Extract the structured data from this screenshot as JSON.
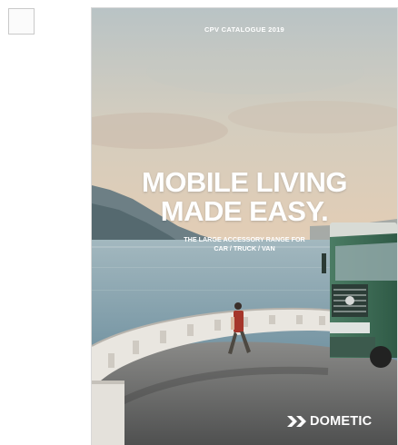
{
  "catalogue": {
    "eyebrow": "CPV CATALOGUE 2019",
    "headline_line1": "MOBILE LIVING",
    "headline_line2": "MADE EASY.",
    "subline1": "THE LARGE ACCESSORY RANGE FOR",
    "subline2": "CAR / TRUCK / VAN",
    "brand": "DOMETIC"
  },
  "icons": {
    "logo": "dometic-chevron-logo-icon"
  },
  "colors": {
    "sea": "#7f9fae",
    "truck": "#3f6e58",
    "text": "#ffffff"
  }
}
